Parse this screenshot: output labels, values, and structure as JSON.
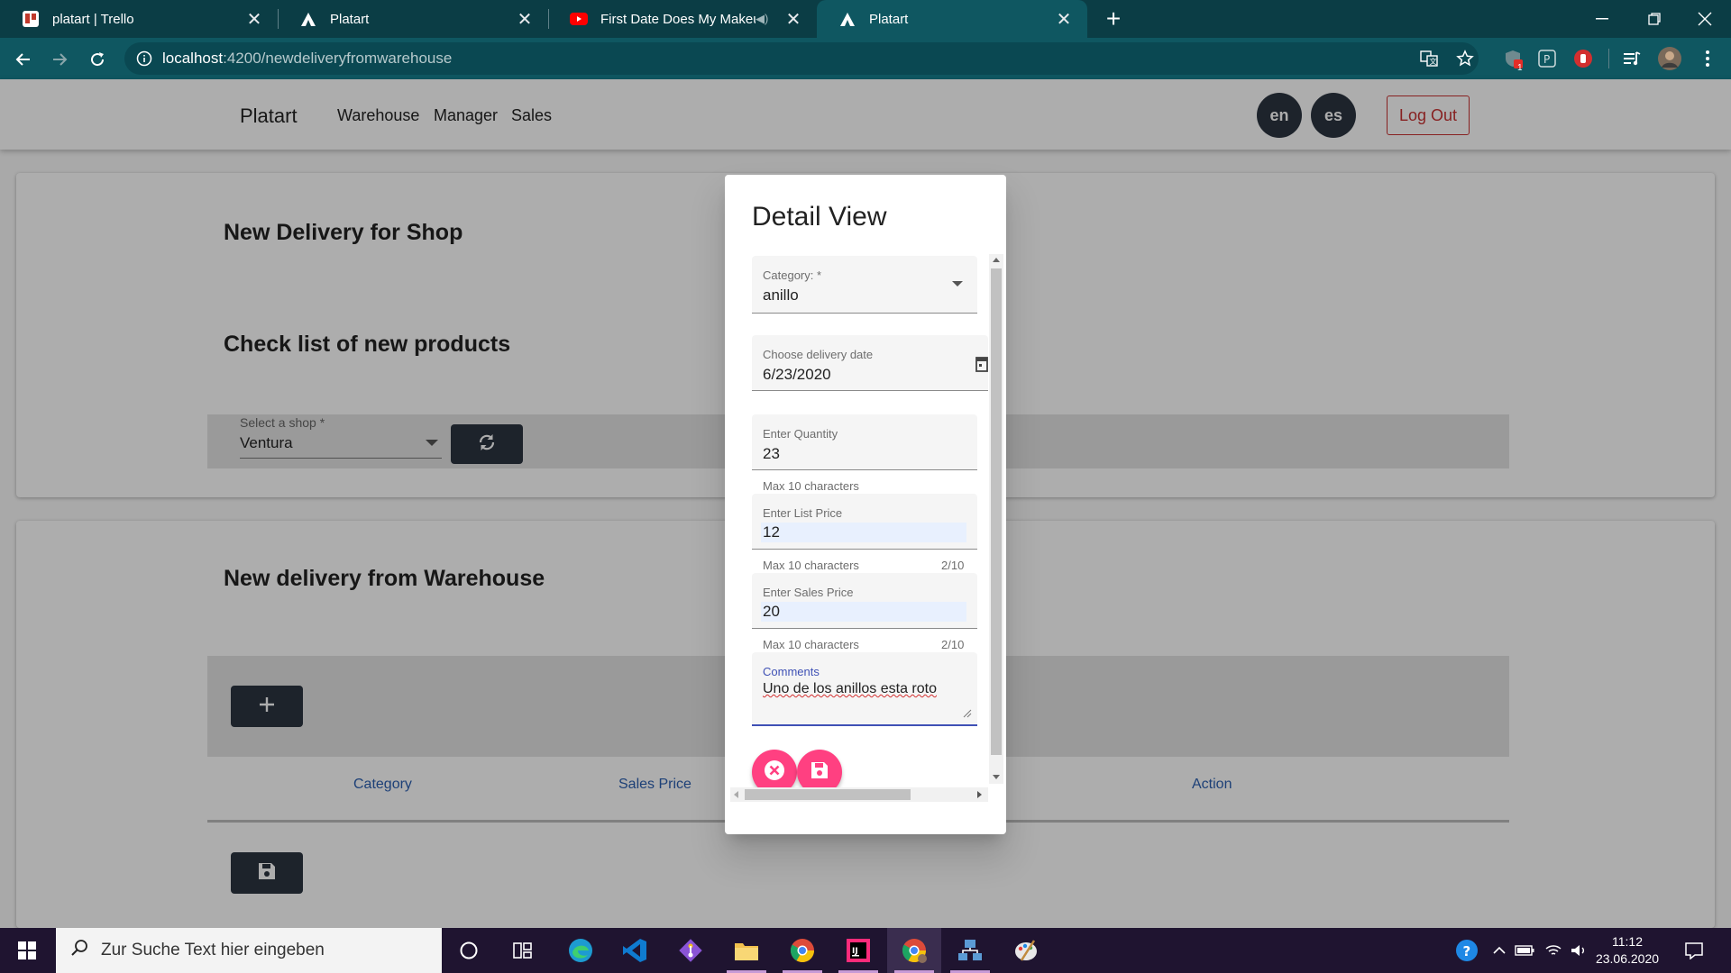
{
  "browser": {
    "tabs": [
      {
        "title": "platart | Trello",
        "close": "✕",
        "icon": "trello-icon"
      },
      {
        "title": "Platart",
        "close": "✕",
        "icon": "platart-icon"
      },
      {
        "title": "First Date Does My Makeup",
        "close": "✕",
        "icon": "youtube-icon"
      },
      {
        "title": "Platart",
        "close": "✕",
        "icon": "platart-icon"
      }
    ],
    "active_tab_index": 3,
    "new_tab": "+",
    "url_host": "localhost",
    "url_path": ":4200/newdeliveryfromwarehouse",
    "notification_badge": "1",
    "accent_color": "#0f5761"
  },
  "app": {
    "brand": "Platart",
    "nav": [
      "Warehouse",
      "Manager",
      "Sales"
    ],
    "lang_en": "en",
    "lang_es": "es",
    "logout": "Log Out"
  },
  "shop_card": {
    "title": "New Delivery for Shop",
    "subtitle": "Check list of new products",
    "shop_label": "Select a shop *",
    "shop_value": "Ventura"
  },
  "warehouse_card": {
    "title": "New delivery from Warehouse",
    "columns": [
      "Category",
      "Sales Price",
      "Action"
    ]
  },
  "dialog": {
    "title": "Detail View",
    "category_label": "Category: *",
    "category_value": "anillo",
    "date_label": "Choose delivery date",
    "date_value": "6/23/2020",
    "quantity_label": "Enter Quantity",
    "quantity_value": "23",
    "quantity_hint": "Max 10 characters",
    "list_price_label": "Enter List Price",
    "list_price_value": "12",
    "list_price_hint": "Max 10 characters",
    "list_price_counter": "2/10",
    "sales_price_label": "Enter Sales Price",
    "sales_price_value": "20",
    "sales_price_hint": "Max 10 characters",
    "sales_price_counter": "2/10",
    "comments_label": "Comments",
    "comments_value": "Uno de los anillos esta roto",
    "accent_color": "#ff4081"
  },
  "taskbar": {
    "search_placeholder": "Zur Suche Text hier eingeben",
    "time": "11:12",
    "date": "23.06.2020"
  }
}
